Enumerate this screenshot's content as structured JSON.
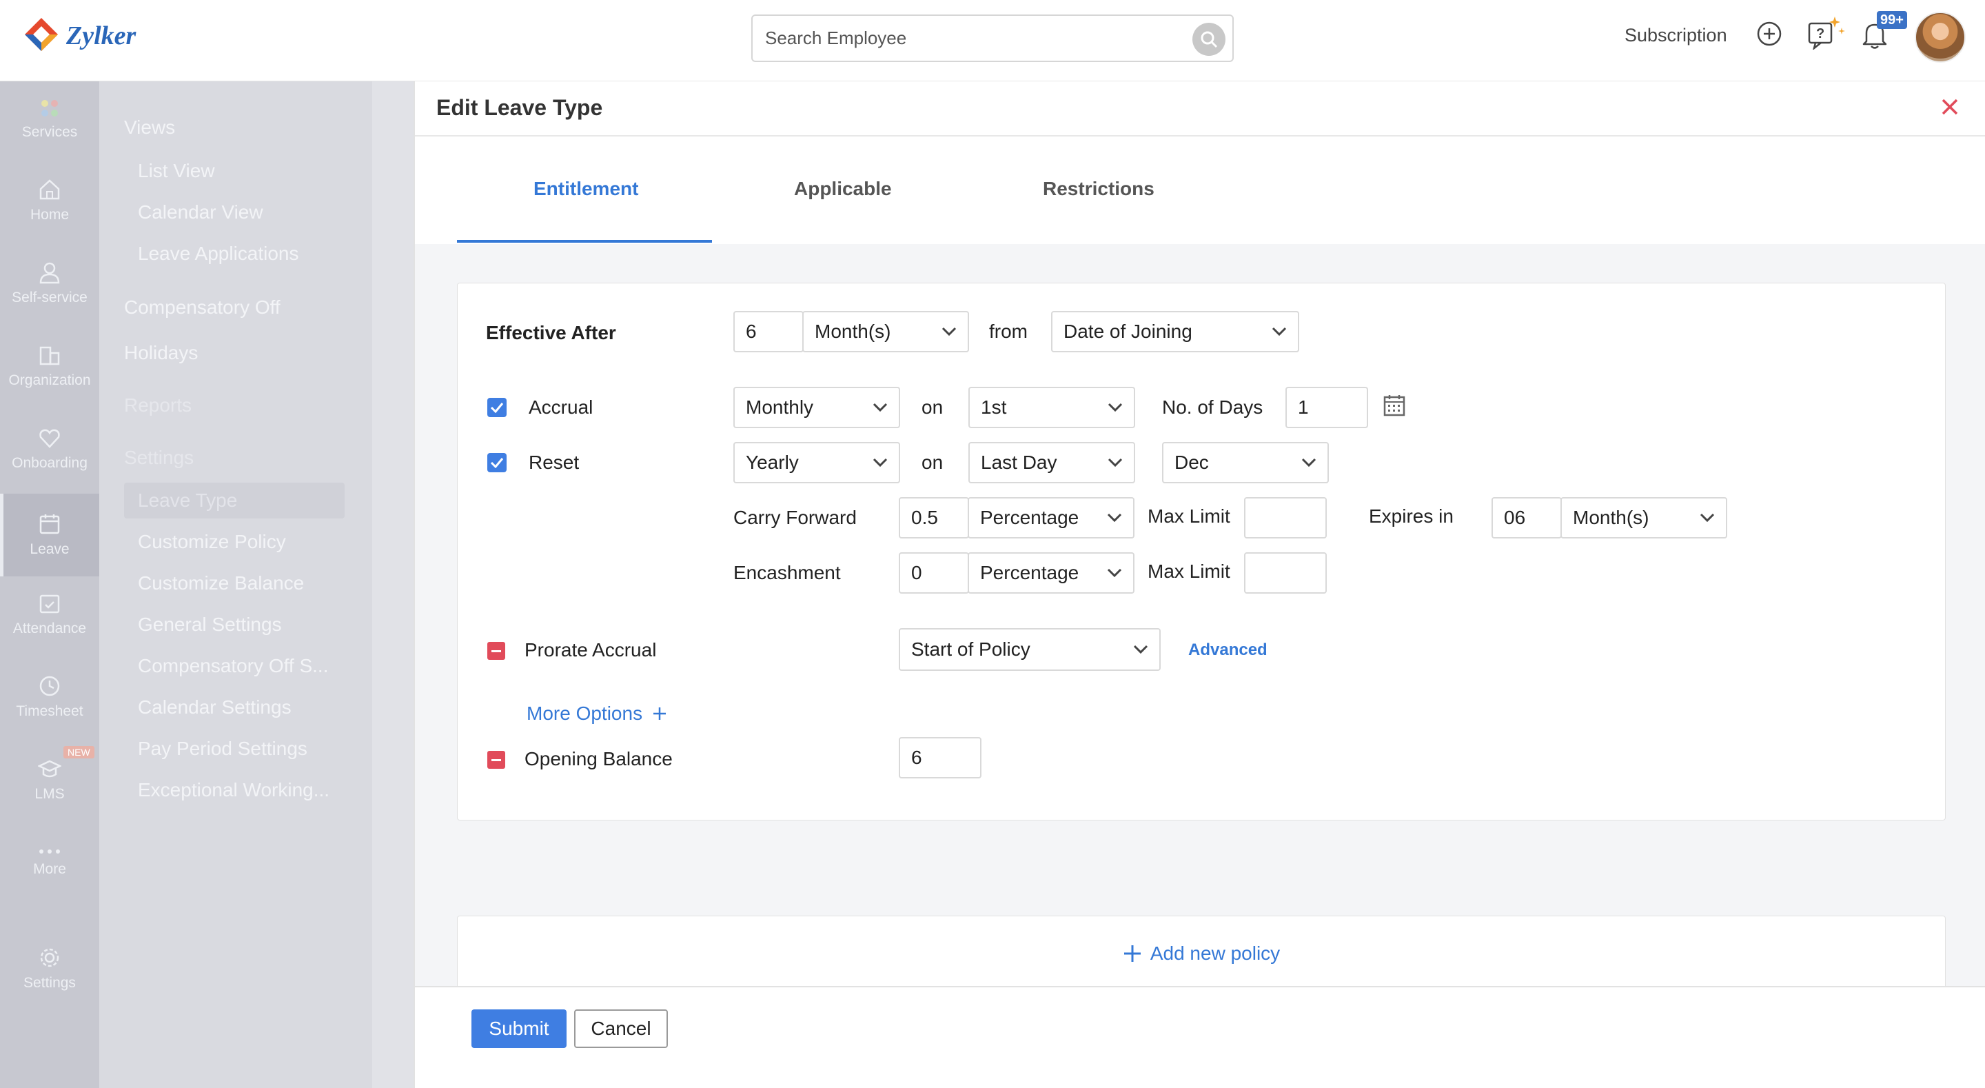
{
  "app": {
    "logo_text": "Zylker",
    "search_placeholder": "Search Employee",
    "subscription_label": "Subscription",
    "notification_badge": "99+"
  },
  "sidebar": {
    "rail": [
      {
        "label": "Services",
        "icon": "services-icon"
      },
      {
        "label": "Home",
        "icon": "home-icon"
      },
      {
        "label": "Self-service",
        "icon": "user-icon"
      },
      {
        "label": "Organization",
        "icon": "organization-icon"
      },
      {
        "label": "Onboarding",
        "icon": "onboarding-icon"
      },
      {
        "label": "Leave",
        "icon": "calendar-icon",
        "active": true
      },
      {
        "label": "Attendance",
        "icon": "attendance-icon"
      },
      {
        "label": "Timesheet",
        "icon": "clock-icon"
      },
      {
        "label": "LMS",
        "icon": "graduation-cap-icon",
        "tag": "NEW"
      },
      {
        "label": "More",
        "icon": "more-icon"
      },
      {
        "label": "Settings",
        "icon": "gear-icon"
      }
    ],
    "nav": {
      "views": "Views",
      "list_view": "List View",
      "calendar_view": "Calendar View",
      "leave_applications": "Leave Applications",
      "compensatory_off": "Compensatory Off",
      "holidays": "Holidays",
      "reports": "Reports",
      "settings": "Settings",
      "leave_type": "Leave Type",
      "customize_policy": "Customize Policy",
      "customize_balance": "Customize Balance",
      "general_settings": "General Settings",
      "compensatory_off_s": "Compensatory Off S...",
      "calendar_settings": "Calendar Settings",
      "pay_period_settings": "Pay Period Settings",
      "exceptional_working": "Exceptional Working..."
    }
  },
  "panel": {
    "title": "Edit Leave Type",
    "tabs": [
      "Entitlement",
      "Applicable",
      "Restrictions"
    ],
    "effective_after": {
      "label": "Effective After",
      "value": "6",
      "unit": "Month(s)",
      "from_label": "from",
      "from_value": "Date of Joining"
    },
    "accrual": {
      "label": "Accrual",
      "checked": true,
      "frequency": "Monthly",
      "on_label": "on",
      "day": "1st",
      "days_label": "No. of Days",
      "days_value": "1"
    },
    "reset": {
      "label": "Reset",
      "checked": true,
      "frequency": "Yearly",
      "on_label": "on",
      "day": "Last Day",
      "month": "Dec"
    },
    "carry_forward": {
      "label": "Carry Forward",
      "value": "0.5",
      "type": "Percentage",
      "max_label": "Max Limit",
      "max_value": "",
      "expires_label": "Expires in",
      "expires_value": "06",
      "expires_unit": "Month(s)"
    },
    "encashment": {
      "label": "Encashment",
      "value": "0",
      "type": "Percentage",
      "max_label": "Max Limit",
      "max_value": ""
    },
    "prorate": {
      "label": "Prorate Accrual",
      "value": "Start of Policy",
      "advanced_label": "Advanced"
    },
    "more_options": "More Options",
    "opening_balance": {
      "label": "Opening Balance",
      "value": "6"
    },
    "add_policy": "Add new policy",
    "submit": "Submit",
    "cancel": "Cancel"
  },
  "colors": {
    "accent": "#3478d6",
    "danger": "#e14b5a",
    "checkbox": "#3f7ee2"
  }
}
